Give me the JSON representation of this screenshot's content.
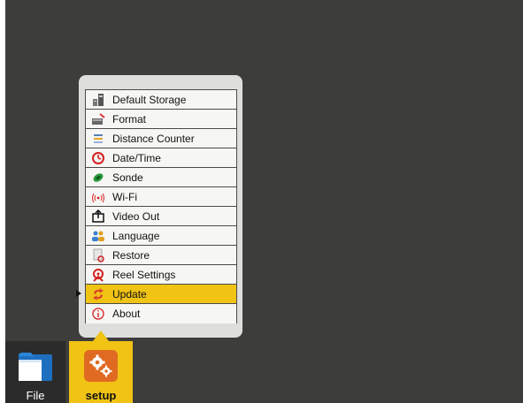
{
  "menu": {
    "items": [
      {
        "label": "Default Storage",
        "icon": "storage-icon"
      },
      {
        "label": "Format",
        "icon": "format-icon"
      },
      {
        "label": "Distance Counter",
        "icon": "distance-counter-icon"
      },
      {
        "label": "Date/Time",
        "icon": "clock-icon"
      },
      {
        "label": "Sonde",
        "icon": "sonde-icon"
      },
      {
        "label": "Wi-Fi",
        "icon": "wifi-icon"
      },
      {
        "label": "Video Out",
        "icon": "video-out-icon"
      },
      {
        "label": "Language",
        "icon": "language-icon"
      },
      {
        "label": "Restore",
        "icon": "restore-icon"
      },
      {
        "label": "Reel Settings",
        "icon": "reel-icon"
      },
      {
        "label": "Update",
        "icon": "update-icon"
      },
      {
        "label": "About",
        "icon": "info-icon"
      }
    ],
    "selected_label": "Update"
  },
  "taskbar": {
    "file_label": "File",
    "setup_label": "setup"
  },
  "colors": {
    "background": "#3d3d3b",
    "popup": "#dededc",
    "selected": "#f0c315",
    "setup_tile": "#f0c315",
    "setup_icon": "#e06a22",
    "file_icon": "#1f6fc0"
  }
}
